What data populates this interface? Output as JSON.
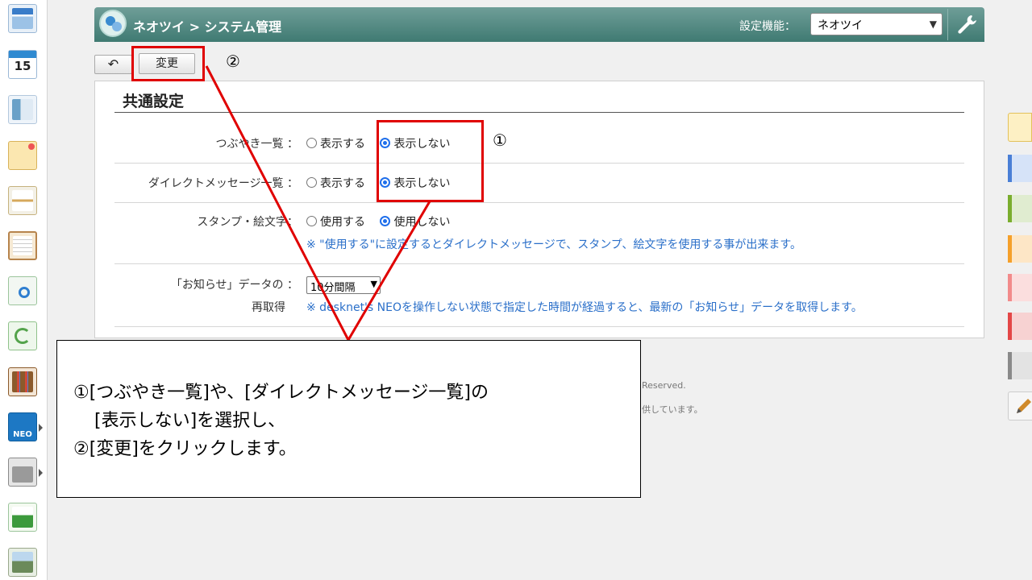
{
  "sidebar": {
    "icons": [
      {
        "name": "portal-icon",
        "color": "#3a7dc9"
      },
      {
        "name": "calendar-icon",
        "label": "15",
        "color": "#2f8ad1"
      },
      {
        "name": "presentation-icon",
        "color": "#6aa1c8"
      },
      {
        "name": "memo-icon",
        "color": "#e8b64a"
      },
      {
        "name": "bulletin-board-icon",
        "color": "#d6a85c"
      },
      {
        "name": "clipboard-icon",
        "color": "#b7844c"
      },
      {
        "name": "search-document-icon",
        "color": "#5aa35a"
      },
      {
        "name": "recycle-document-icon",
        "color": "#53a34b"
      },
      {
        "name": "binders-icon",
        "color": "#8b5a2b"
      },
      {
        "name": "neo-app-icon",
        "label": "NEO",
        "color": "#1d78c4"
      },
      {
        "name": "folder-icon",
        "color": "#7a7a7a"
      },
      {
        "name": "green-app-icon",
        "color": "#3c9a3c"
      },
      {
        "name": "landscape-app-icon",
        "color": "#6b8a5a"
      }
    ]
  },
  "header": {
    "title": "ネオツイ > システム管理",
    "setting_label": "設定機能：",
    "setting_value": "ネオツイ"
  },
  "toolbar": {
    "back_label": "↶",
    "change_label": "変更",
    "callout_change_num": "②"
  },
  "panel": {
    "title": "共通設定",
    "rows": {
      "tweets": {
        "label": "つぶやき一覧 ：",
        "option_show": "表示する",
        "option_hide": "表示しない",
        "selected": "表示しない"
      },
      "dm": {
        "label": "ダイレクトメッセージ一覧 ：",
        "option_show": "表示する",
        "option_hide": "表示しない",
        "selected": "表示しない"
      },
      "stamp": {
        "label": "スタンプ・絵文字：",
        "option_use": "使用する",
        "option_nouse": "使用しない",
        "selected": "使用しない",
        "note": "※ \"使用する\"に設定するとダイレクトメッセージで、スタンプ、絵文字を使用する事が出来ます。"
      },
      "notice": {
        "label_line1": "「お知らせ」データの ：",
        "label_line2": "再取得",
        "interval_value": "10分間隔",
        "note": "※ desknet's NEOを操作しない状態で指定した時間が経過すると、最新の「お知らせ」データを取得します。"
      }
    },
    "callout_radio_num": "①"
  },
  "footer": {
    "line1_fragment": "Reserved.",
    "line2_fragment": "供しています。"
  },
  "right_tabs": [
    {
      "name": "note-tab-icon",
      "color": "#f4c542"
    },
    {
      "name": "blue-tab",
      "color": "#4a7fd6"
    },
    {
      "name": "green-tab",
      "color": "#7aad2e"
    },
    {
      "name": "orange-tab",
      "color": "#f5a02a"
    },
    {
      "name": "pink-tab",
      "color": "#f28b8b"
    },
    {
      "name": "red-tab",
      "color": "#e34747"
    },
    {
      "name": "gray-tab",
      "color": "#8a8a8a"
    },
    {
      "name": "pencil-tab-icon",
      "color": "#d08a2a"
    }
  ],
  "instruction": {
    "line1": "①[つぶやき一覧]や、[ダイレクトメッセージ一覧]の",
    "line2": "[表示しない]を選択し、",
    "line3": "②[変更]をクリックします。"
  },
  "colors": {
    "annotation_red": "#e00000",
    "header_teal": "#4a857d",
    "note_blue": "#2a6fc9"
  }
}
